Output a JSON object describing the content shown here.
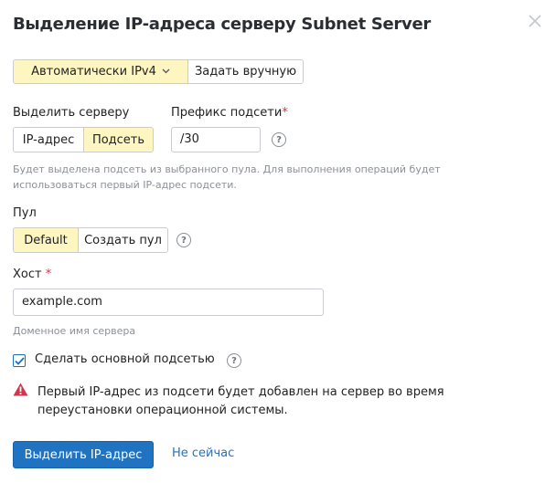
{
  "dialog": {
    "title": "Выделение IP-адреса серверу Subnet Server"
  },
  "mode": {
    "options": [
      "Автоматически IPv4",
      "Задать вручную"
    ],
    "selected": "Автоматически IPv4",
    "dropdown_icon": "chevron-down-icon"
  },
  "assign": {
    "label": "Выделить серверу",
    "options": [
      "IP-адрес",
      "Подсеть"
    ],
    "selected": "Подсеть"
  },
  "prefix": {
    "label": "Префикс подсети",
    "required_mark": "*",
    "value": "/30",
    "help_icon": "?"
  },
  "assign_hint": {
    "line1": "Будет выделена подсеть из выбранного пула. Для выполнения операций будет",
    "line2": "использоваться первый IP-адрес подсети."
  },
  "pool": {
    "label": "Пул",
    "options": [
      "Default",
      "Создать пул"
    ],
    "selected": "Default",
    "help_icon": "?"
  },
  "host": {
    "label": "Хост",
    "required_mark": "*",
    "value": "example.com",
    "hint": "Доменное имя сервера"
  },
  "primary_subnet": {
    "label": "Сделать основной подсетью",
    "checked": true,
    "help_icon": "?"
  },
  "warning": {
    "line1": "Первый IP-адрес из подсети будет добавлен на сервер во время",
    "line2": "переустановки операционной системы.",
    "color": "#d6334a"
  },
  "actions": {
    "submit_label": "Выделить IP-адрес",
    "cancel_label": "Не сейчас"
  },
  "colors": {
    "accent": "#1f73c1",
    "active_segment": "#fdf6c0",
    "required": "#d6334a"
  }
}
